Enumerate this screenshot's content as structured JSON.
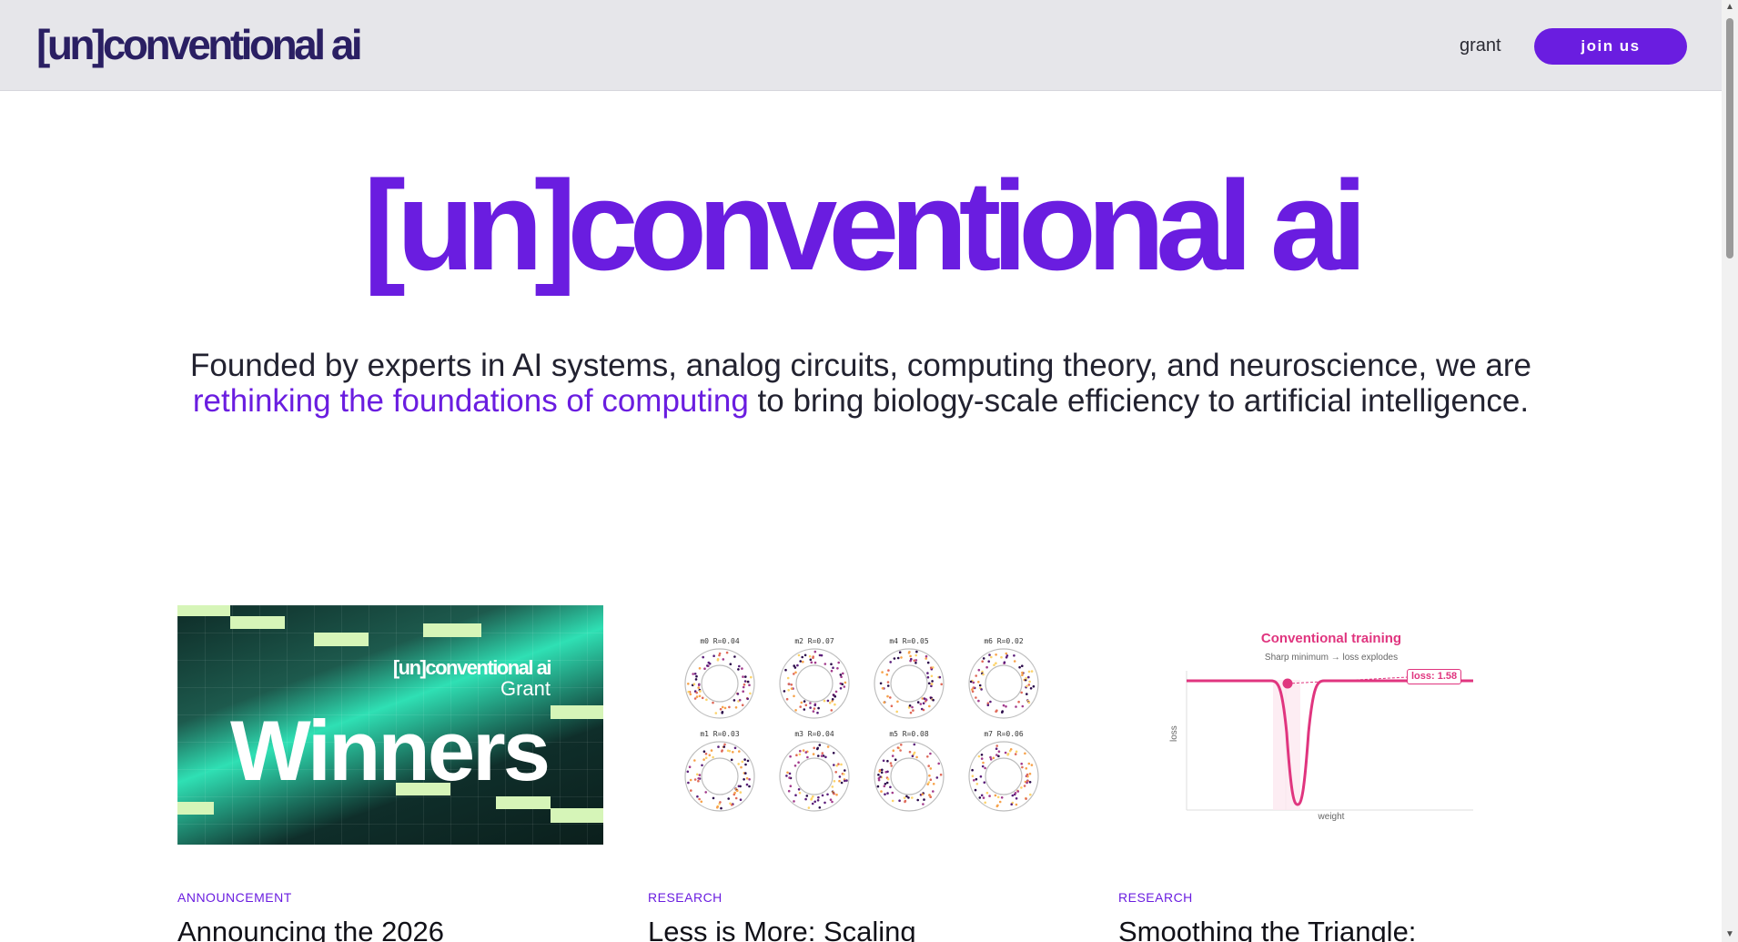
{
  "header": {
    "logo": "[un]conventional ai",
    "nav_grant": "grant",
    "join_label": "join us"
  },
  "hero": {
    "logo": "[un]conventional ai",
    "tagline_part1": "Founded by experts in AI systems, analog circuits, computing theory, and neuroscience, we are ",
    "tagline_highlight": "rethinking the foundations of computing",
    "tagline_part2": " to bring biology-scale efficiency to artificial intelligence."
  },
  "cards": [
    {
      "tag": "ANNOUNCEMENT",
      "title": "Announcing the 2026",
      "image": {
        "brand": "[un]conventional ai",
        "sub": "Grant",
        "word": "Winners"
      }
    },
    {
      "tag": "RESEARCH",
      "title": "Less is More: Scaling",
      "image": {
        "panels": [
          "m0 R=0.04",
          "m2 R=0.07",
          "m4 R=0.05",
          "m6 R=0.02",
          "m1 R=0.03",
          "m3 R=0.04",
          "m5 R=0.08",
          "m7 R=0.06"
        ]
      }
    },
    {
      "tag": "RESEARCH",
      "title": "Smoothing the Triangle:",
      "image": {
        "title": "Conventional training",
        "subtitle": "Sharp minimum → loss explodes",
        "badge": "loss: 1.58",
        "xlabel": "weight",
        "ylabel": "loss"
      }
    }
  ],
  "colors": {
    "accent": "#6a1de0",
    "header_bg": "#e6e6ea",
    "chart_pink": "#e0357f"
  }
}
